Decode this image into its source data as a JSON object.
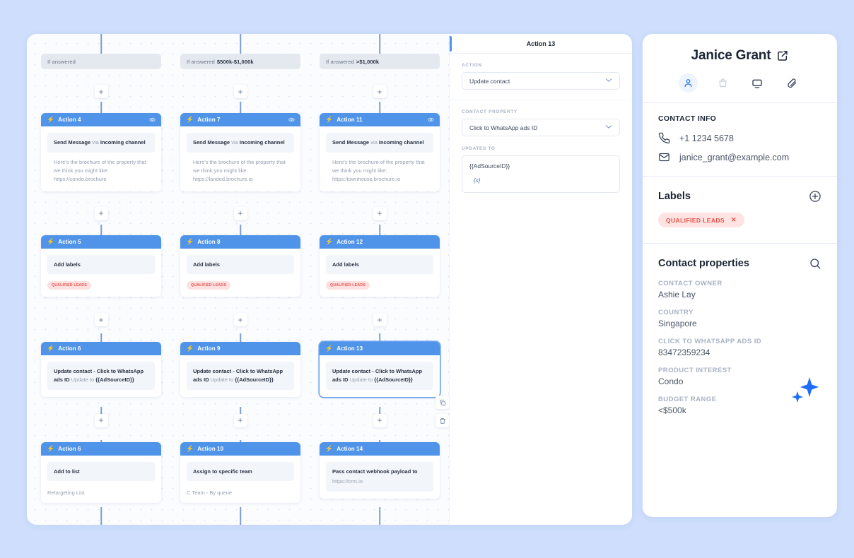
{
  "theme": {
    "page_bg": "#cedefc",
    "accent_blue": "#4f94e8",
    "tag_red_bg": "#fde0e0",
    "tag_red_text": "#e8524d",
    "sparkle_blue": "#1d6ef5"
  },
  "workflow": {
    "columns": [
      {
        "condition_prefix": "If answered",
        "condition_value": "",
        "cards": [
          {
            "title": "Action 4",
            "icon": "bolt-icon",
            "right_icon": "eye-icon",
            "block_type": "message",
            "block_title_parts": [
              "Send Message",
              "via",
              "Incoming channel"
            ],
            "message": "Here's the brochure of the property that we think you might like: https://condo.brochure"
          },
          {
            "title": "Action 5",
            "icon": "bolt-icon",
            "right_icon": "",
            "block_type": "labels",
            "block_title": "Add labels",
            "tag": "QUALIFIED LEADS"
          },
          {
            "title": "Action 6",
            "icon": "bolt-icon",
            "right_icon": "",
            "block_type": "update",
            "bold_part": "Update contact - Click to WhatsApp ads ID",
            "muted_part": "Update to",
            "value_part": "{{AdSourceID}}"
          },
          {
            "title": "Action 6",
            "icon": "bolt-icon",
            "right_icon": "",
            "block_type": "simple",
            "block_title": "Add to list",
            "subtext": "Retargeting List"
          }
        ]
      },
      {
        "condition_prefix": "If answered",
        "condition_value": "$500k-$1,000k",
        "cards": [
          {
            "title": "Action 7",
            "icon": "bolt-icon",
            "right_icon": "eye-icon",
            "block_type": "message",
            "block_title_parts": [
              "Send Message",
              "via",
              "Incoming channel"
            ],
            "message": "Here's the brochure of the property that we think you might like: https://landed.brochure.io"
          },
          {
            "title": "Action 8",
            "icon": "bolt-icon",
            "right_icon": "",
            "block_type": "labels",
            "block_title": "Add labels",
            "tag": "QUALIFIED LEADS"
          },
          {
            "title": "Action 9",
            "icon": "bolt-icon",
            "right_icon": "",
            "block_type": "update",
            "bold_part": "Update contact - Click to WhatsApp ads ID",
            "muted_part": "Update to",
            "value_part": "{{AdSourceID}}"
          },
          {
            "title": "Action 10",
            "icon": "bolt-icon",
            "right_icon": "",
            "block_type": "simple",
            "block_title": "Assign to specific team",
            "subtext": "C Team - By queue"
          }
        ]
      },
      {
        "condition_prefix": "If answered",
        "condition_value": ">$1,000k",
        "cards": [
          {
            "title": "Action 11",
            "icon": "bolt-icon",
            "right_icon": "eye-icon",
            "block_type": "message",
            "block_title_parts": [
              "Send Message",
              "via",
              "Incoming channel"
            ],
            "message": "Here's the brochure of the property that we think you might like: https:/townhouse.brochure.io"
          },
          {
            "title": "Action 12",
            "icon": "bolt-icon",
            "right_icon": "",
            "block_type": "labels",
            "block_title": "Add labels",
            "tag": "QUALIFIED LEADS"
          },
          {
            "title": "Action 13",
            "icon": "bolt-icon",
            "right_icon": "",
            "selected": true,
            "block_type": "update",
            "bold_part": "Update contact - Click to WhatsApp ads ID",
            "muted_part": "Update to",
            "value_part": "{{AdSourceID}}"
          },
          {
            "title": "Action 14",
            "icon": "bolt-icon",
            "right_icon": "",
            "block_type": "webhook",
            "block_title": "Pass contact webhook payload to",
            "block_sub": "https://crm.io"
          }
        ]
      }
    ],
    "add_button_label": "+",
    "side_tools": [
      {
        "name": "duplicate-icon"
      },
      {
        "name": "delete-icon"
      }
    ]
  },
  "action_panel": {
    "title": "Action 13",
    "fields": [
      {
        "label": "ACTION",
        "value": "Update contact",
        "type": "select"
      },
      {
        "label": "CONTACT PROPERTY",
        "value": "Click to WhatsApp ads ID",
        "type": "select"
      },
      {
        "label": "UPDATES TO",
        "value": "{{AdSourceID}}",
        "fx": "{x}",
        "type": "code"
      }
    ]
  },
  "contact": {
    "name": "Janice Grant",
    "open_icon": "external-link-icon",
    "tabs": [
      {
        "name": "contact-tab",
        "icon": "person-icon",
        "active": true
      },
      {
        "name": "orders-tab",
        "icon": "shopping-bag-icon",
        "active": false
      },
      {
        "name": "sessions-tab",
        "icon": "monitor-icon",
        "active": false
      },
      {
        "name": "files-tab",
        "icon": "paperclip-icon",
        "active": false
      }
    ],
    "contact_info": {
      "heading": "CONTACT INFO",
      "phone": "+1 1234 5678",
      "email": "janice_grant@example.com"
    },
    "labels": {
      "heading": "Labels",
      "add_icon": "plus-circle-icon",
      "items": [
        {
          "text": "QUALIFIED LEADS",
          "remove_icon": "close-icon"
        }
      ]
    },
    "properties": {
      "heading": "Contact properties",
      "search_icon": "search-icon",
      "items": [
        {
          "key": "CONTACT OWNER",
          "value": "Ashie Lay"
        },
        {
          "key": "COUNTRY",
          "value": "Singapore"
        },
        {
          "key": "CLICK TO WHATSAPP ADS ID",
          "value": "83472359234"
        },
        {
          "key": "PRODUCT INTEREST",
          "value": "Condo"
        },
        {
          "key": "BUDGET RANGE",
          "value": "<$500k"
        }
      ]
    }
  }
}
